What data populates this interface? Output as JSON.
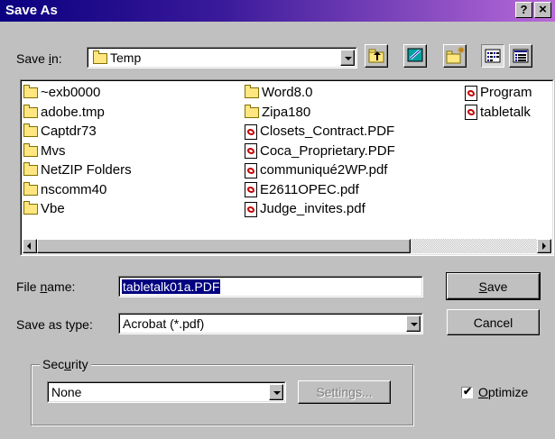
{
  "window": {
    "title": "Save As",
    "help_label": "?",
    "close_label": "×"
  },
  "save_in": {
    "label_prefix": "Save ",
    "label_u": "i",
    "label_suffix": "n:",
    "value": "Temp"
  },
  "toolbar": {
    "icons": [
      "up-one-level-icon",
      "desktop-icon",
      "new-folder-icon",
      "list-view-icon",
      "details-view-icon"
    ]
  },
  "files": {
    "col1": [
      {
        "type": "folder",
        "name": "~exb0000"
      },
      {
        "type": "folder",
        "name": "adobe.tmp"
      },
      {
        "type": "folder",
        "name": "Captdr73"
      },
      {
        "type": "folder",
        "name": "Mvs"
      },
      {
        "type": "folder",
        "name": "NetZIP Folders"
      },
      {
        "type": "folder",
        "name": "nscomm40"
      },
      {
        "type": "folder",
        "name": "Vbe"
      }
    ],
    "col2": [
      {
        "type": "folder",
        "name": "Word8.0"
      },
      {
        "type": "folder",
        "name": "Zipa180"
      },
      {
        "type": "pdf",
        "name": "Closets_Contract.PDF"
      },
      {
        "type": "pdf",
        "name": "Coca_Proprietary.PDF"
      },
      {
        "type": "pdf",
        "name": "communiqué2WP.pdf"
      },
      {
        "type": "pdf",
        "name": "E2611OPEC.pdf"
      },
      {
        "type": "pdf",
        "name": "Judge_invites.pdf"
      }
    ],
    "col3": [
      {
        "type": "pdf",
        "name": "Program"
      },
      {
        "type": "pdf",
        "name": "tabletalk"
      }
    ]
  },
  "file_name": {
    "label_prefix": "File ",
    "label_u": "n",
    "label_suffix": "ame:",
    "value": "tabletalk01a.PDF"
  },
  "save_as_type": {
    "label": "Save as type:",
    "value": "Acrobat (*.pdf)"
  },
  "buttons": {
    "save_u": "S",
    "save_rest": "ave",
    "cancel": "Cancel",
    "settings": "Settings..."
  },
  "security": {
    "label_prefix": "Sec",
    "label_u": "u",
    "label_suffix": "rity",
    "value": "None"
  },
  "optimize": {
    "label_u": "O",
    "label_rest": "ptimize",
    "checked": true,
    "mark": "✔"
  }
}
